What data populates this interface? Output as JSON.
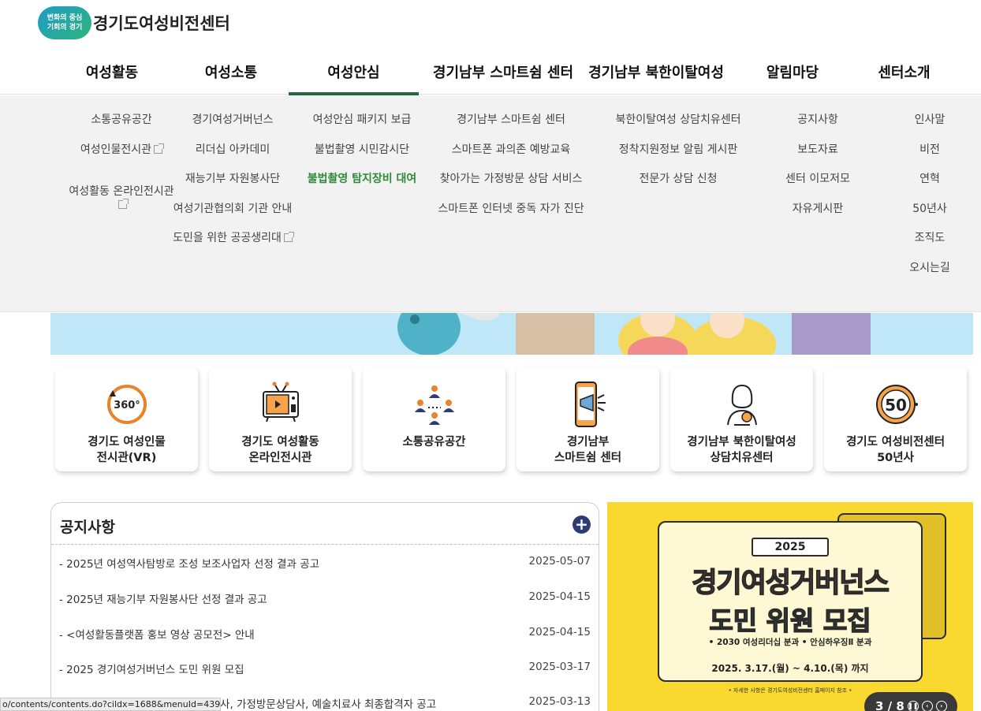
{
  "logo": {
    "badge_line1": "변화의 중심",
    "badge_line2": "기회의 경기",
    "title": "경기도여성비전센터"
  },
  "gnb": [
    {
      "label": "여성활동",
      "active": false
    },
    {
      "label": "여성소통",
      "active": false
    },
    {
      "label": "여성안심",
      "active": true
    },
    {
      "label": "경기남부 스마트쉼 센터",
      "active": false
    },
    {
      "label": "경기남부 북한이탈여성",
      "active": false
    },
    {
      "label": "알림마당",
      "active": false
    },
    {
      "label": "센터소개",
      "active": false
    }
  ],
  "dropdown": {
    "col1": [
      "소통공유공간",
      "여성인물전시관",
      "여성활동 온라인전시관"
    ],
    "col2": [
      "경기여성거버넌스",
      "리더십 아카데미",
      "재능기부 자원봉사단",
      "여성기관협의회 기관 안내",
      "도민을 위한 공공생리대"
    ],
    "col3": [
      "여성안심 패키지 보급",
      "불법촬영 시민감시단",
      "불법촬영 탐지장비 대여"
    ],
    "col4": [
      "경기남부 스마트쉼 센터",
      "스마트폰 과의존 예방교육",
      "찾아가는 가정방문 상담 서비스",
      "스마트폰 인터넷 중독 자가 진단"
    ],
    "col5": [
      "북한이탈여성 상담치유센터",
      "정착지원정보 알림 게시판",
      "전문가 상담 신청"
    ],
    "col6": [
      "공지사항",
      "보도자료",
      "센터 이모저모",
      "자유게시판"
    ],
    "col7": [
      "인사말",
      "비전",
      "연혁",
      "50년사",
      "조직도",
      "오시는길"
    ]
  },
  "quick_cards": [
    {
      "icon": "vr-360-icon",
      "label": "경기도 여성인물\n전시관(VR)"
    },
    {
      "icon": "tv-icon",
      "label": "경기도 여성활동\n온라인전시관"
    },
    {
      "icon": "people-network-icon",
      "label": "소통공유공간"
    },
    {
      "icon": "smartphone-megaphone-icon",
      "label": "경기남부\n스마트쉼 센터"
    },
    {
      "icon": "woman-counseling-icon",
      "label": "경기남부 북한이탈여성\n상담치유센터"
    },
    {
      "icon": "fifty-years-icon",
      "label": "경기도 여성비전센터\n50년사"
    }
  ],
  "notice": {
    "title": "공지사항",
    "more": "+",
    "rows": [
      {
        "title": "2025년 여성역사탐방로 조성 보조사업자 선정 결과 공고",
        "date": "2025-05-07"
      },
      {
        "title": "2025년 재능기부 자원봉사단 선정 결과 공고",
        "date": "2025-04-15"
      },
      {
        "title": "<여성활동플랫폼 홍보 영상 공모전> 안내",
        "date": "2025-04-15"
      },
      {
        "title": "2025 경기여성거버넌스 도민 위원 모집",
        "date": "2025-03-17"
      },
      {
        "title": "경기남부 스마트쉼센터 예방교육강사, 가정방문상담사, 예술치료사 최종합격자 공고",
        "date": "2025-03-13"
      }
    ]
  },
  "promo": {
    "year": "2025",
    "title1": "경기여성거버넌스",
    "title2": "도민 위원 모집",
    "sub": "• 2030 여성리더십 분과   • 안심하우징Ⅱ 분과",
    "date": "2025. 3.17.(월) ~ 4.10.(목) 까지",
    "note": "• 자세한 사항은 경기도여성비전센터 홈페이지 참조 •",
    "pager": "3 / 8"
  },
  "status_url": "o/contents/contents.do?cildx=1688&menuId=4397",
  "colors": {
    "active_underline": "#1e6b43",
    "highlight_link": "#2f8a3a",
    "promo_bg": "#f9d82f",
    "plus_button": "#2f3b73"
  }
}
